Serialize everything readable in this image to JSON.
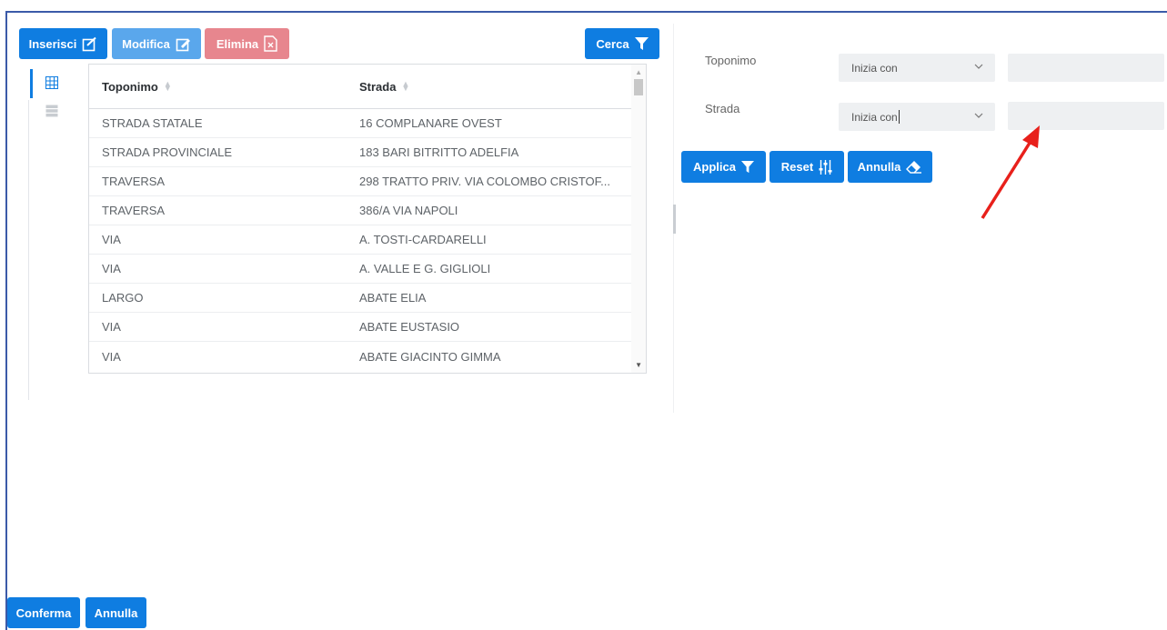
{
  "toolbar": {
    "insert_label": "Inserisci",
    "edit_label": "Modifica",
    "delete_label": "Elimina",
    "search_label": "Cerca"
  },
  "table": {
    "headers": [
      "Toponimo",
      "Strada"
    ],
    "rows": [
      [
        "STRADA STATALE",
        "16 COMPLANARE OVEST"
      ],
      [
        "STRADA PROVINCIALE",
        "183 BARI BITRITTO ADELFIA"
      ],
      [
        "TRAVERSA",
        "298 TRATTO PRIV. VIA COLOMBO CRISTOF..."
      ],
      [
        "TRAVERSA",
        "386/A VIA NAPOLI"
      ],
      [
        "VIA",
        "A. TOSTI-CARDARELLI"
      ],
      [
        "VIA",
        "A. VALLE E G. GIGLIOLI"
      ],
      [
        "LARGO",
        "ABATE ELIA"
      ],
      [
        "VIA",
        "ABATE EUSTASIO"
      ],
      [
        "VIA",
        "ABATE GIACINTO GIMMA"
      ]
    ]
  },
  "filters": {
    "toponimo": {
      "label": "Toponimo",
      "operator": "Inizia con",
      "value": ""
    },
    "strada": {
      "label": "Strada",
      "operator": "Inizia con",
      "value": ""
    }
  },
  "filter_actions": {
    "apply_label": "Applica",
    "reset_label": "Reset",
    "cancel_label": "Annulla"
  },
  "footer": {
    "confirm_label": "Conferma",
    "cancel_label": "Annulla"
  },
  "colors": {
    "primary": "#0f7de1",
    "primary_light": "#5aa7ec",
    "danger_light": "#e7868e",
    "annotation_arrow": "#e8201b"
  },
  "icons": [
    "edit-icon",
    "delete-file-icon",
    "filter-icon",
    "sliders-icon",
    "eraser-icon",
    "grid-view-icon",
    "list-view-icon",
    "chevron-down-icon",
    "sort-icon"
  ]
}
